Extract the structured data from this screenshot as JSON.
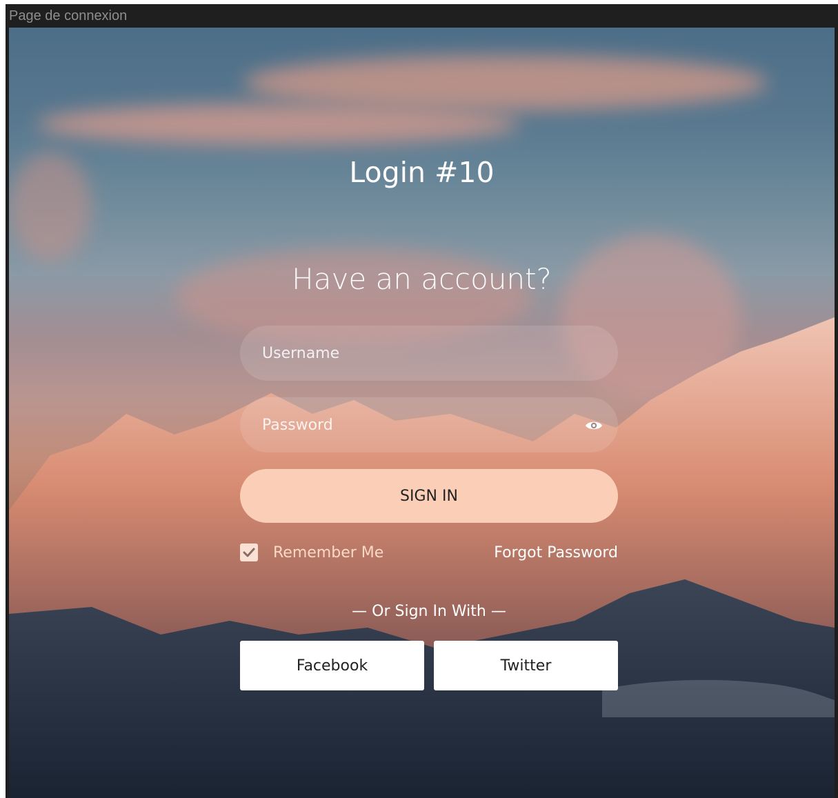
{
  "window": {
    "title": "Page de connexion"
  },
  "page": {
    "brand_title": "Login #10",
    "heading": "Have an account?"
  },
  "form": {
    "username_placeholder": "Username",
    "password_placeholder": "Password",
    "signin_label": "SIGN IN",
    "remember_label": "Remember Me",
    "remember_checked": true,
    "forgot_label": "Forgot Password",
    "divider_text": "— Or Sign In With —"
  },
  "social": {
    "facebook_label": "Facebook",
    "twitter_label": "Twitter"
  },
  "colors": {
    "accent": "#fbcfb7",
    "checkbox": "#fbe1d3",
    "remember_text": "#fbd9c6",
    "titlebar_bg": "#1f1f1f",
    "titlebar_text": "#8e8e8e"
  },
  "icons": {
    "password_toggle": "eye-icon",
    "remember": "check-icon"
  }
}
